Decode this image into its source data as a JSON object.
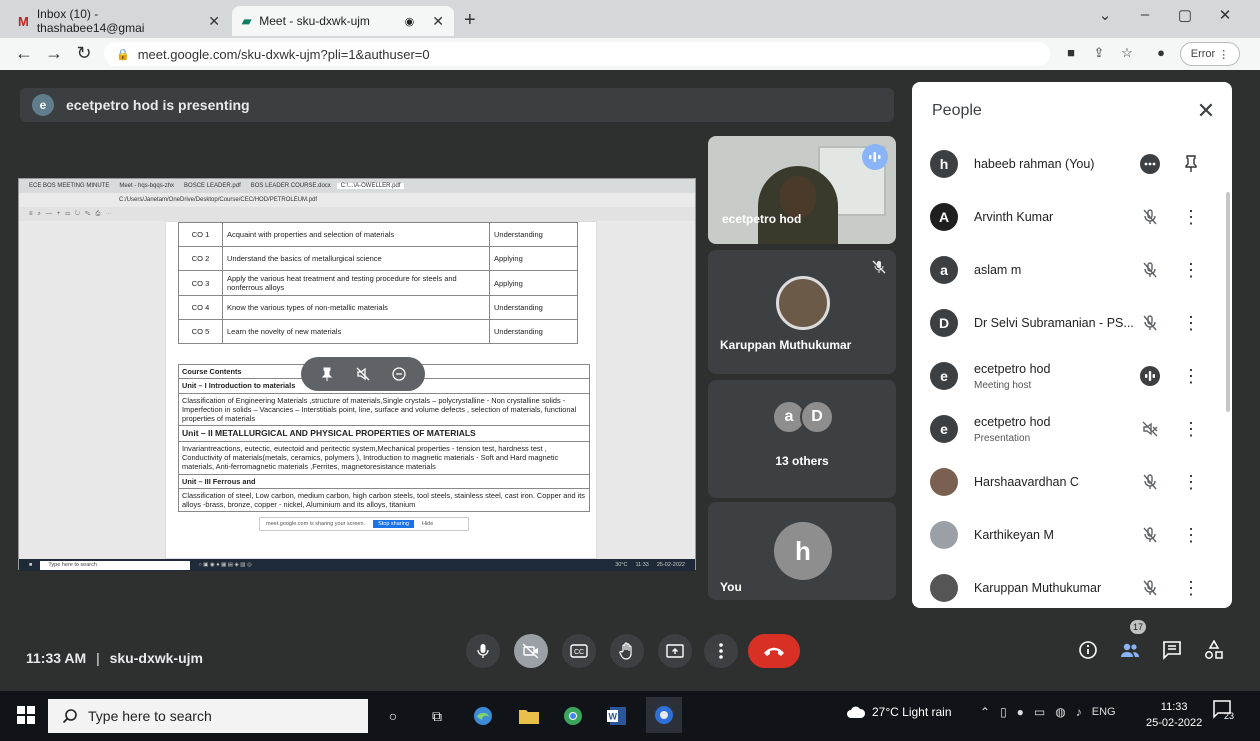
{
  "browser": {
    "tabs": [
      {
        "icon": "M",
        "title": "Inbox (10) - thashabee14@gmai"
      },
      {
        "icon": "M",
        "title": "Meet - sku-dxwk-ujm"
      }
    ],
    "address": "meet.google.com/sku-dxwk-ujm?pli=1&authuser=0",
    "error_label": "Error"
  },
  "meet": {
    "presenting_banner": "ecetpetro hod is presenting",
    "presenter_initial": "e",
    "meeting_code": "sku-dxwk-ujm",
    "time": "11:33 AM",
    "participant_count": "17",
    "tiles": [
      {
        "name": "ecetpetro hod"
      },
      {
        "name": "Karuppan Muthukumar"
      },
      {
        "name": "13 others",
        "initials": [
          "a",
          "D"
        ]
      },
      {
        "name": "You",
        "initial": "h"
      }
    ]
  },
  "shared_screen": {
    "tabs": [
      "ECE BOS MEETING MINUTE",
      "Meet - hqs-bqqs-zhx",
      "BOSCE LEADER.pdf",
      "BOS LEADER COURSE.docx",
      "C:\\...\\A-OWELLER.pdf"
    ],
    "address": "C:/Users/Janetam/OneDrive/Desktop/Course/CEC/HOD/PETROLEUM.pdf",
    "course_outcomes": [
      {
        "code": "CO 1",
        "desc": "Acquaint with properties and selection of materials",
        "level": "Understanding"
      },
      {
        "code": "CO 2",
        "desc": "Understand the basics of metallurgical science",
        "level": "Applying"
      },
      {
        "code": "CO 3",
        "desc": "Apply the various heat treatment and testing procedure for steels and nonferrous alloys",
        "level": "Applying"
      },
      {
        "code": "CO 4",
        "desc": "Know the various types of non-metallic materials",
        "level": "Understanding"
      },
      {
        "code": "CO 5",
        "desc": "Learn the novelty of new materials",
        "level": "Understanding"
      }
    ],
    "course_contents_title": "Course Contents",
    "unit1_title": "Unit – I     Introduction to materials",
    "unit1_text": "Classification of Engineering Materials ,structure of materials,Single crystals – polycrystalline - Non crystalline solids - Imperfection in solids – Vacancies – Interstitials point, line, surface and volume defects , selection of materials, functional properties of materials",
    "unit2_title": "Unit – II     METALLURGICAL AND PHYSICAL PROPERTIES OF MATERIALS",
    "unit2_text": "Invariantreactions, eutectic, eutectoid and peritectic system,Mechanical properties - tension test, hardness test , Conductivity of materials(metals, ceramics, polymers ), Introduction to magnetic materials - Soft and Hard magnetic materials, Anti-ferromagnetic materials ,Ferrites, magnetoresistance materials",
    "unit3_title": "Unit – III     Ferrous and",
    "unit3_text": "Classification of steel, Low carbon, medium carbon, high carbon steels, tool steels, stainless steel, cast iron. Copper and its alloys -brass, bronze, copper - nickel, Aluminium and its alloys, titanium",
    "share_message": "meet.google.com is sharing your screen.",
    "stop_sharing": "Stop sharing",
    "hide": "Hide",
    "taskbar_search": "Type here to search",
    "taskbar_temp": "30°C",
    "taskbar_time": "11:33",
    "taskbar_date": "25-02-2022"
  },
  "people": {
    "title": "People",
    "list": [
      {
        "initial": "h",
        "name": "habeeb rahman (You)",
        "sub": "",
        "color": "#3c4043"
      },
      {
        "initial": "A",
        "name": "Arvinth Kumar",
        "sub": "",
        "color": "#1f1f1f"
      },
      {
        "initial": "a",
        "name": "aslam m",
        "sub": "",
        "color": "#3c4043"
      },
      {
        "initial": "D",
        "name": "Dr Selvi Subramanian - PS...",
        "sub": "",
        "color": "#3c4043"
      },
      {
        "initial": "e",
        "name": "ecetpetro hod",
        "sub": "Meeting host",
        "color": "#3c4043"
      },
      {
        "initial": "e",
        "name": "ecetpetro hod",
        "sub": "Presentation",
        "color": "#3c4043"
      },
      {
        "initial": "",
        "name": "Harshaavardhan C",
        "sub": "",
        "color": "#7a6050"
      },
      {
        "initial": "",
        "name": "Karthikeyan M",
        "sub": "",
        "color": "#9aa0a6"
      },
      {
        "initial": "",
        "name": "Karuppan Muthukumar",
        "sub": "",
        "color": "#555"
      }
    ]
  },
  "taskbar": {
    "search_placeholder": "Type here to search",
    "weather": "27°C  Light rain",
    "lang": "ENG",
    "time": "11:33",
    "date": "25-02-2022",
    "notifications": "23"
  },
  "colors": {
    "accent": "#1a73e8",
    "end_call": "#d93025",
    "meet_bg": "#2e3030"
  }
}
